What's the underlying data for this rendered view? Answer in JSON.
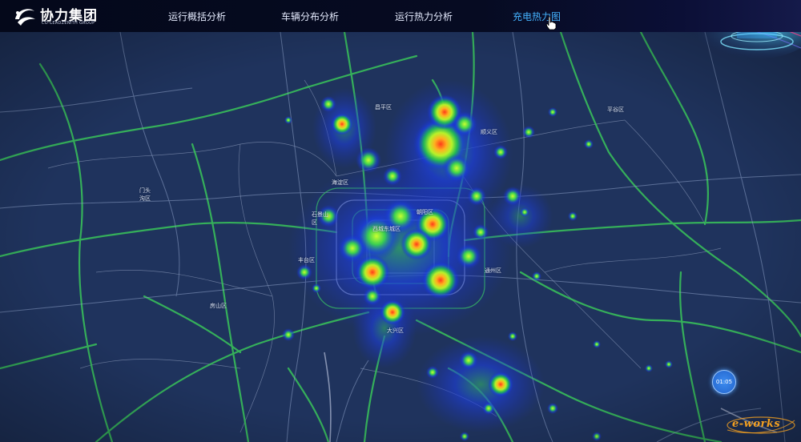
{
  "header": {
    "logo_title": "协力集团",
    "logo_subtitle": "CO-LEADZENITH GROUP",
    "nav": [
      {
        "label": "运行概括分析",
        "active": false
      },
      {
        "label": "车辆分布分析",
        "active": false
      },
      {
        "label": "运行热力分析",
        "active": false
      },
      {
        "label": "充电热力图",
        "active": true
      }
    ]
  },
  "map": {
    "districts": [
      "昌平区",
      "顺义区",
      "平谷区",
      "门头沟区",
      "海淀区",
      "石景山区",
      "朝阳区",
      "西城东城区",
      "丰台区",
      "通州区",
      "房山区",
      "大兴区"
    ],
    "time_badge": "01:05"
  },
  "watermark": {
    "text": "e-works"
  },
  "colors": {
    "accent": "#45b3ff",
    "road": "#39c55a",
    "map_bg": "#1b2d52"
  }
}
